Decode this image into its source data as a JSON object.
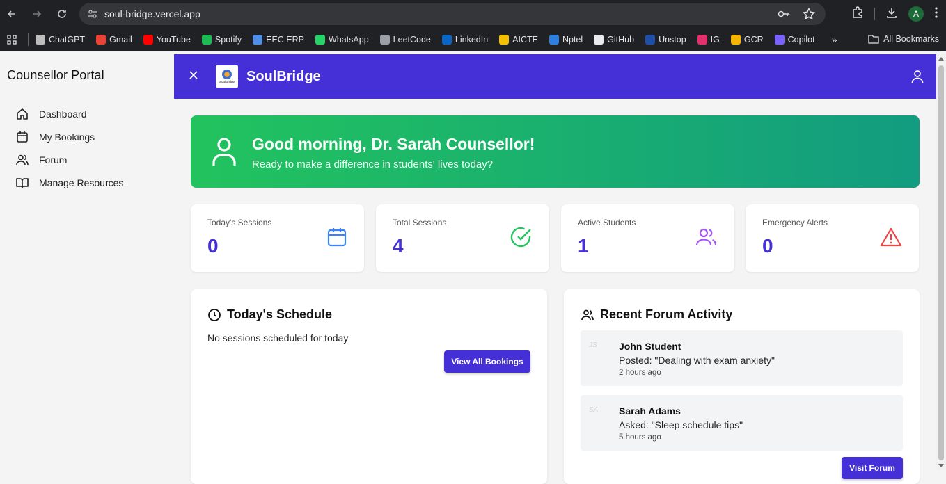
{
  "browser": {
    "url": "soul-bridge.vercel.app",
    "profile_initial": "A",
    "bookmarks": [
      {
        "label": "ChatGPT",
        "color": "#bdbdbd"
      },
      {
        "label": "Gmail",
        "color": "#ea4335"
      },
      {
        "label": "YouTube",
        "color": "#ff0000"
      },
      {
        "label": "Spotify",
        "color": "#1db954"
      },
      {
        "label": "EEC ERP",
        "color": "#4f8fe6"
      },
      {
        "label": "WhatsApp",
        "color": "#25d366"
      },
      {
        "label": "LeetCode",
        "color": "#9aa0a6"
      },
      {
        "label": "LinkedIn",
        "color": "#0a66c2"
      },
      {
        "label": "AICTE",
        "color": "#f2c200"
      },
      {
        "label": "Nptel",
        "color": "#2f7fe0"
      },
      {
        "label": "GitHub",
        "color": "#e8eaed"
      },
      {
        "label": "Unstop",
        "color": "#1f4fa8"
      },
      {
        "label": "IG",
        "color": "#e1306c"
      },
      {
        "label": "GCR",
        "color": "#f4b400"
      },
      {
        "label": "Copilot",
        "color": "#7b61ff"
      }
    ],
    "more_label": "»",
    "all_bookmarks": "All Bookmarks"
  },
  "sidebar": {
    "title": "Counsellor Portal",
    "items": [
      {
        "label": "Dashboard",
        "icon": "home-icon"
      },
      {
        "label": "My Bookings",
        "icon": "calendar-icon"
      },
      {
        "label": "Forum",
        "icon": "users-icon"
      },
      {
        "label": "Manage Resources",
        "icon": "book-icon"
      }
    ]
  },
  "header": {
    "brand": "SoulBridge",
    "logo_text": "SoulBridge",
    "color": "#4430d6"
  },
  "greeting": {
    "title": "Good morning, Dr. Sarah Counsellor!",
    "subtitle": "Ready to make a difference in students' lives today?"
  },
  "stats": [
    {
      "label": "Today's Sessions",
      "value": "0",
      "icon": "calendar-icon",
      "color": "#3b82f6"
    },
    {
      "label": "Total Sessions",
      "value": "4",
      "icon": "check-circle-icon",
      "color": "#22c55e"
    },
    {
      "label": "Active Students",
      "value": "1",
      "icon": "users-icon",
      "color": "#a855f7"
    },
    {
      "label": "Emergency Alerts",
      "value": "0",
      "icon": "alert-triangle-icon",
      "color": "#ef4444"
    }
  ],
  "schedule": {
    "title": "Today's Schedule",
    "empty": "No sessions scheduled for today",
    "button": "View All Bookings"
  },
  "forum": {
    "title": "Recent Forum Activity",
    "items": [
      {
        "initials": "JS",
        "name": "John Student",
        "text": "Posted: \"Dealing with exam anxiety\"",
        "time": "2 hours ago"
      },
      {
        "initials": "SA",
        "name": "Sarah Adams",
        "text": "Asked: \"Sleep schedule tips\"",
        "time": "5 hours ago"
      }
    ],
    "button": "Visit Forum"
  }
}
